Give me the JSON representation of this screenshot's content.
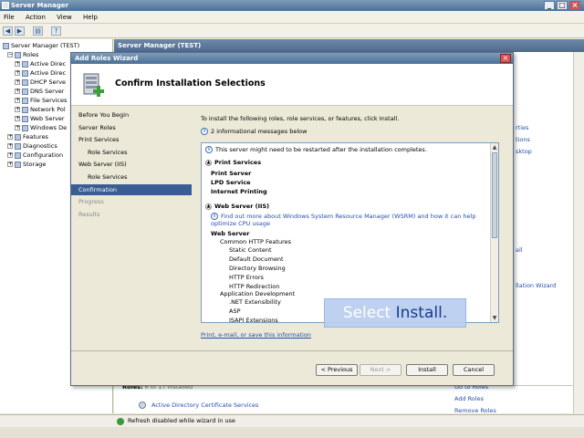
{
  "window": {
    "title": "Server Manager"
  },
  "menu": [
    "File",
    "Action",
    "View",
    "Help"
  ],
  "tree": {
    "root": "Server Manager (TEST)",
    "roles_label": "Roles",
    "role_items": [
      "Active Direc",
      "Active Direc",
      "DHCP Serve",
      "DNS Server",
      "File Services",
      "Network Pol",
      "Web Server",
      "Windows De"
    ],
    "other_items": [
      "Features",
      "Diagnostics",
      "Configuration",
      "Storage"
    ]
  },
  "right_pane": {
    "header": "Server Manager (TEST)",
    "links": [
      "rties",
      "tions",
      "sktop",
      "all",
      "llation Wizard"
    ],
    "bottom": {
      "roles_label": "Roles:",
      "roles_count": "6 of 17 installed",
      "role_link": "Active Directory Certificate Services",
      "actions": [
        "Go to Roles",
        "Add Roles",
        "Remove Roles"
      ]
    }
  },
  "status": {
    "text": "Refresh disabled while wizard in use"
  },
  "wizard": {
    "title": "Add Roles Wizard",
    "heading": "Confirm Installation Selections",
    "nav": [
      {
        "label": "Before You Begin",
        "state": "normal",
        "sub": false
      },
      {
        "label": "Server Roles",
        "state": "normal",
        "sub": false
      },
      {
        "label": "Print Services",
        "state": "normal",
        "sub": false
      },
      {
        "label": "Role Services",
        "state": "normal",
        "sub": true
      },
      {
        "label": "Web Server (IIS)",
        "state": "normal",
        "sub": false
      },
      {
        "label": "Role Services",
        "state": "normal",
        "sub": true
      },
      {
        "label": "Confirmation",
        "state": "selected",
        "sub": false
      },
      {
        "label": "Progress",
        "state": "disabled",
        "sub": false
      },
      {
        "label": "Results",
        "state": "disabled",
        "sub": false
      }
    ],
    "intro": "To install the following roles, role services, or features, click Install.",
    "info_count": "2 informational messages below",
    "restart_note": "This server might need to be restarted after the installation completes.",
    "print_section": {
      "title": "Print Services",
      "items": [
        "Print Server",
        "LPD Service",
        "Internet Printing"
      ]
    },
    "web_section": {
      "title": "Web Server (IIS)",
      "info_link": "Find out more about Windows System Resource Manager (WSRM) and how it can help optimize CPU usage",
      "sub_title": "Web Server",
      "group1": "Common HTTP Features",
      "group1_items": [
        "Static Content",
        "Default Document",
        "Directory Browsing",
        "HTTP Errors",
        "HTTP Redirection"
      ],
      "group2": "Application Development",
      "group2_items": [
        ".NET Extensibility",
        "ASP",
        "ISAPI Extensions"
      ]
    },
    "print_link": "Print, e-mail, or save this information",
    "buttons": {
      "previous": "< Previous",
      "next": "Next >",
      "install": "Install",
      "cancel": "Cancel"
    }
  },
  "tooltip": {
    "part1": "Select",
    "part2": "Install."
  }
}
